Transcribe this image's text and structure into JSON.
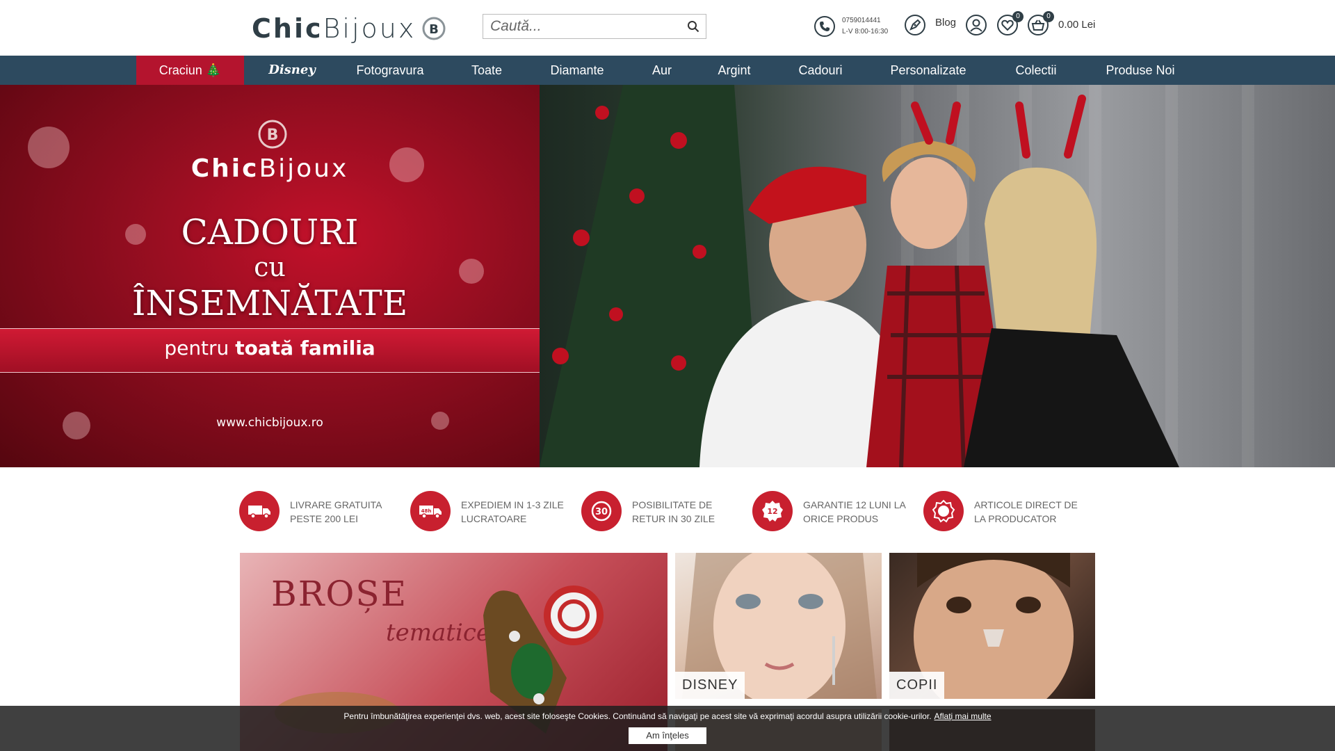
{
  "header": {
    "logo_part1": "Chic",
    "logo_part2": "Bijoux",
    "search_placeholder": "Caută...",
    "phone_number": "0759014441",
    "phone_hours": "L-V 8:00-16:30",
    "blog_label": "Blog",
    "favorites_count": "0",
    "cart_count": "0",
    "cart_total": "0.00 Lei"
  },
  "nav": {
    "items": [
      {
        "label": "Craciun 🎄",
        "active": true
      },
      {
        "label": "Disney"
      },
      {
        "label": "Fotogravura"
      },
      {
        "label": "Toate"
      },
      {
        "label": "Diamante"
      },
      {
        "label": "Aur"
      },
      {
        "label": "Argint"
      },
      {
        "label": "Cadouri"
      },
      {
        "label": "Personalizate"
      },
      {
        "label": "Colectii"
      },
      {
        "label": "Produse Noi"
      }
    ]
  },
  "hero": {
    "logo_part1": "Chic",
    "logo_part2": "Bijoux",
    "title_line1": "CADOURI",
    "title_line2": "cu",
    "title_line3": "ÎNSEMNĂTATE",
    "band_prefix": "pentru",
    "band_bold": "toată familia",
    "url": "www.chicbijoux.ro"
  },
  "features": [
    {
      "icon": "truck-icon",
      "line1": "Livrare gratuita",
      "line2": "peste 200 Lei"
    },
    {
      "icon": "48h-truck-icon",
      "line1": "Expediem in 1-3 zile",
      "line2": "lucratoare"
    },
    {
      "icon": "return-30-icon",
      "line1": "Posibilitate de",
      "line2": "retur in 30 zile"
    },
    {
      "icon": "warranty-12-icon",
      "line1": "Garantie 12 luni la",
      "line2": "orice produs"
    },
    {
      "icon": "original-badge-icon",
      "line1": "Articole direct de",
      "line2": "la producator"
    }
  ],
  "tiles": {
    "brose_title": "BROȘE",
    "brose_subtitle": "tematice",
    "disney_label": "DISNEY",
    "copii_label": "COPII"
  },
  "cookie": {
    "message": "Pentru îmbunătăţirea experienţei dvs. web, acest site foloseşte Cookies. Continuând să navigaţi pe acest site vă exprimaţi acordul asupra utilizării cookie-urilor.",
    "link": "Aflaţi mai multe",
    "button": "Am înţeles"
  },
  "colors": {
    "nav_bg": "#2d4a5f",
    "nav_active": "#b4142e",
    "accent_red": "#c8202f",
    "logo_dark": "#2f3e46"
  }
}
